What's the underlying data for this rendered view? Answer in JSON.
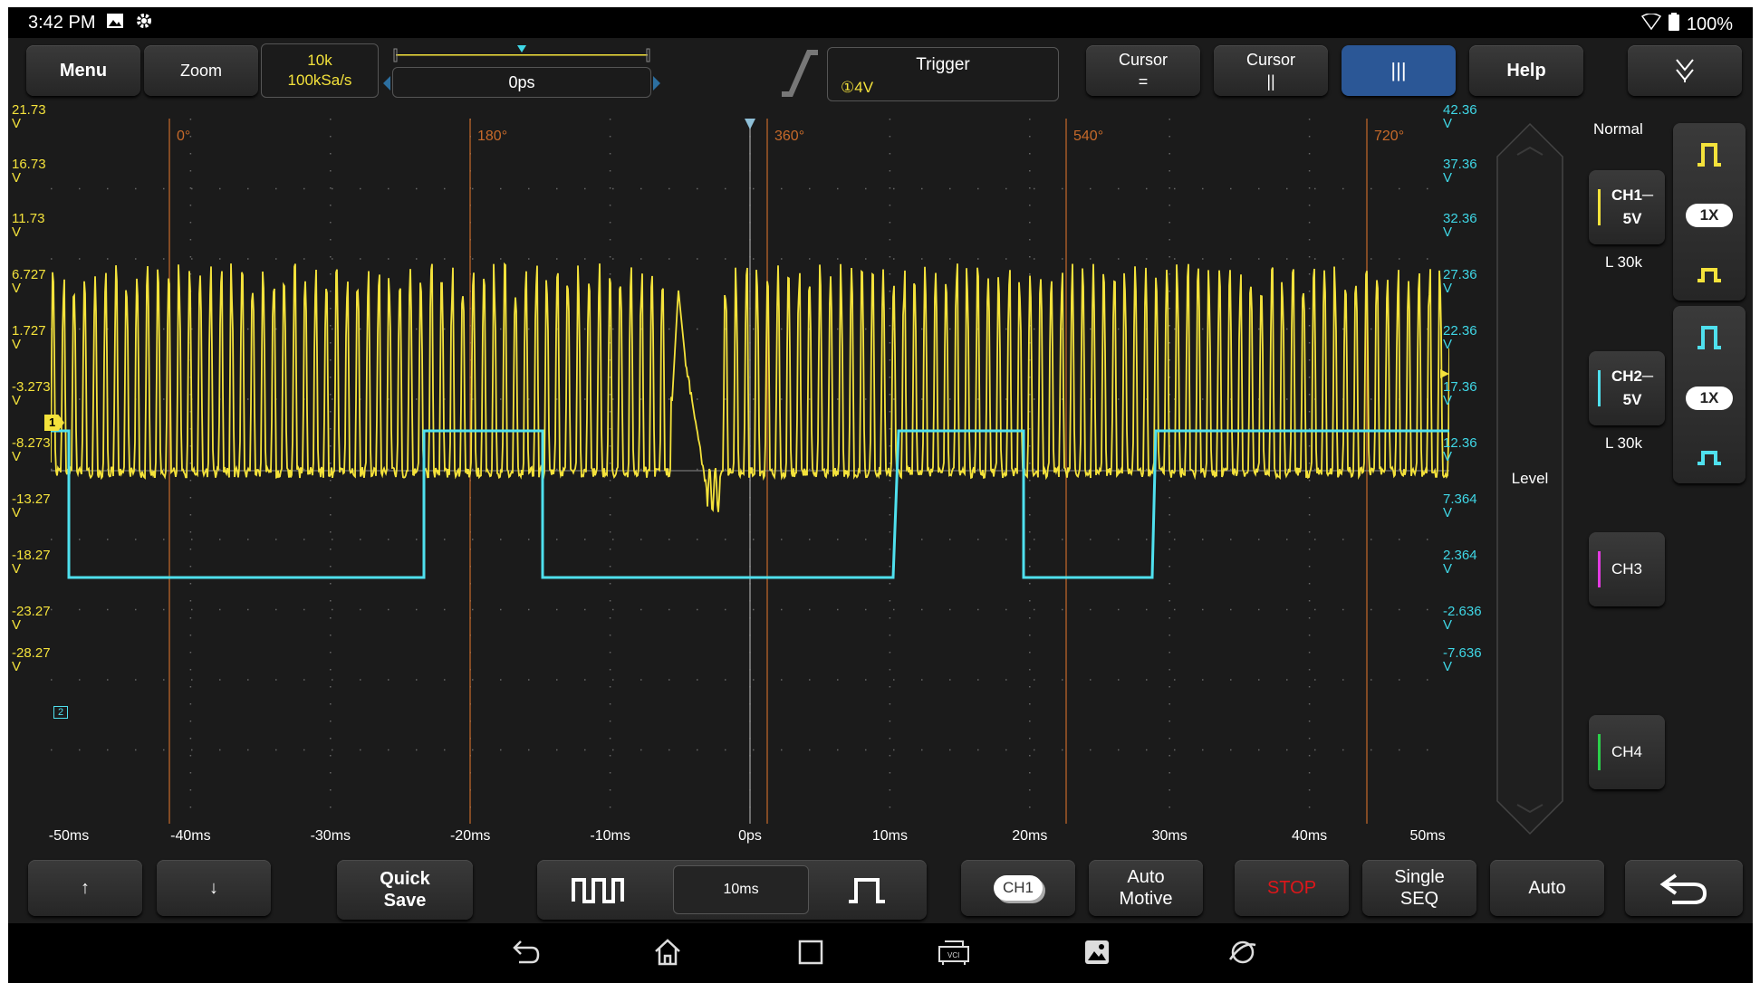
{
  "status": {
    "time": "3:42 PM",
    "battery": "100%"
  },
  "toolbar": {
    "menu": "Menu",
    "zoom": "Zoom",
    "timebase_points": "10k",
    "sample_rate": "100kSa/s",
    "position": "0ps",
    "trigger_label": "Trigger",
    "trigger_value": "①4V",
    "cursor_h": "Cursor",
    "cursor_h_sym": "=",
    "cursor_v": "Cursor",
    "cursor_v_sym": "||",
    "cursor_active_sym": "|||",
    "help": "Help",
    "collapse_sym": "≫"
  },
  "plot": {
    "left_axis": [
      "21.73\nV",
      "16.73\nV",
      "11.73\nV",
      "6.727\nV",
      "1.727\nV",
      "-3.273\nV",
      "-8.273\nV",
      "-13.27\nV",
      "-18.27\nV",
      "-23.27\nV",
      "-28.27\nV"
    ],
    "right_axis": [
      "42.36\nV",
      "37.36\nV",
      "32.36\nV",
      "27.36\nV",
      "22.36\nV",
      "17.36\nV",
      "12.36\nV",
      "7.364\nV",
      "2.364\nV",
      "-2.636\nV",
      "-7.636\nV"
    ],
    "time_axis": [
      "-50ms",
      "-40ms",
      "-30ms",
      "-20ms",
      "-10ms",
      "0ps",
      "10ms",
      "20ms",
      "30ms",
      "40ms",
      "50ms"
    ],
    "phase_labels": [
      "0°",
      "180°",
      "360°",
      "540°",
      "720°"
    ],
    "ch1_marker": "1",
    "ch2_marker": "2",
    "level_label": "Level",
    "colors": {
      "ch1": "#f4e23b",
      "ch2": "#4fe0ee",
      "phase": "#c76a2a",
      "grid": "#555555"
    }
  },
  "right_panel": {
    "mode": "Normal",
    "ch1": {
      "label": "CH1",
      "scale": "5V",
      "coupling": "─",
      "probe": "1X",
      "impedance": "L 30k"
    },
    "ch2": {
      "label": "CH2",
      "scale": "5V",
      "coupling": "─",
      "probe": "1X",
      "impedance": "L 30k"
    },
    "ch3": {
      "label": "CH3"
    },
    "ch4": {
      "label": "CH4"
    }
  },
  "bottom": {
    "up": "↑",
    "down": "↓",
    "quick_save_1": "Quick",
    "quick_save_2": "Save",
    "timebase": "10ms",
    "channel_select": "CH1",
    "auto_motive_1": "Auto",
    "auto_motive_2": "Motive",
    "stop": "STOP",
    "single_1": "Single",
    "single_2": "SEQ",
    "auto": "Auto"
  }
}
